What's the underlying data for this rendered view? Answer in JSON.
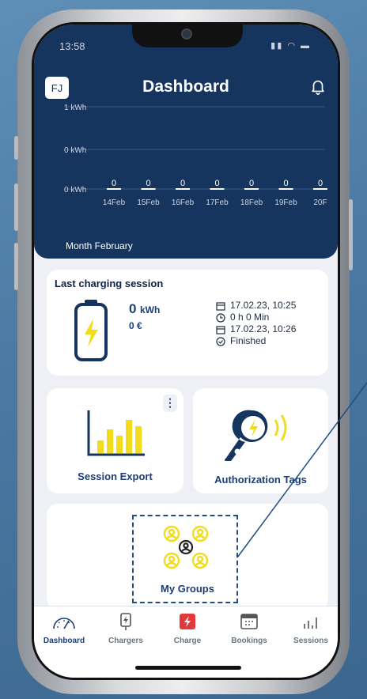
{
  "status": {
    "time": "13:58"
  },
  "header": {
    "avatar_initials": "FJ",
    "title": "Dashboard",
    "month_label": "Month February"
  },
  "chart_data": {
    "type": "bar",
    "y_tick_labels": [
      "1 kWh",
      "0 kWh",
      "0 kWh"
    ],
    "categories": [
      "14Feb",
      "15Feb",
      "16Feb",
      "17Feb",
      "18Feb",
      "19Feb",
      "20F"
    ],
    "values": [
      0,
      0,
      0,
      0,
      0,
      0,
      0
    ],
    "value_labels": [
      "0",
      "0",
      "0",
      "0",
      "0",
      "0",
      "0"
    ],
    "xlabel": "",
    "ylabel": "",
    "title": ""
  },
  "last_session": {
    "title": "Last charging session",
    "energy_value": "0",
    "energy_unit": "kWh",
    "cost": "0 €",
    "start": "17.02.23, 10:25",
    "duration": "0 h 0 Min",
    "end": "17.02.23, 10:26",
    "status": "Finished"
  },
  "tiles": {
    "session_export": "Session Export",
    "more_glyph": "⋮",
    "authorization_tags": "Authorization Tags",
    "my_groups": "My Groups"
  },
  "tabs": [
    {
      "label": "Dashboard"
    },
    {
      "label": "Chargers"
    },
    {
      "label": "Charge"
    },
    {
      "label": "Bookings"
    },
    {
      "label": "Sessions"
    }
  ],
  "colors": {
    "primary": "#15355e",
    "accent_yellow": "#f2dd1c",
    "charge_red": "#e23a3a"
  }
}
